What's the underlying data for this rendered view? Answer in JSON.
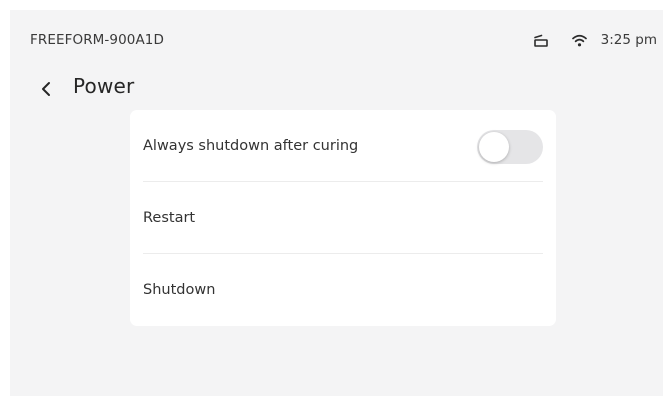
{
  "status_bar": {
    "device_name": "FREEFORM-900A1D",
    "time": "3:25 pm",
    "icons": [
      "tray-icon",
      "wifi-icon"
    ]
  },
  "header": {
    "back_icon": "chevron-left-icon",
    "title": "Power"
  },
  "settings": {
    "always_shutdown": {
      "label": "Always shutdown after curing",
      "enabled": false
    },
    "restart_label": "Restart",
    "shutdown_label": "Shutdown"
  },
  "colors": {
    "background": "#f4f4f5",
    "card": "#ffffff",
    "toggle_off": "#e5e5e7",
    "text": "#333333"
  }
}
